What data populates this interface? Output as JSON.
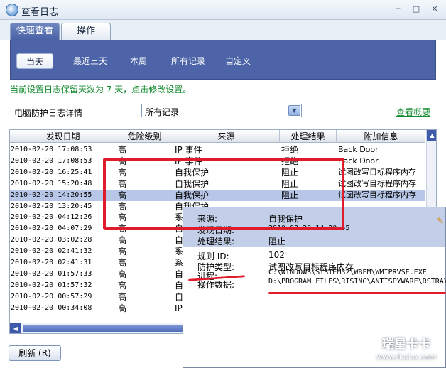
{
  "window": {
    "title": "查看日志",
    "controls": [
      "─",
      "□",
      "✕"
    ]
  },
  "tabs": [
    {
      "label": "快速查看",
      "active": true
    },
    {
      "label": "操作",
      "active": false
    }
  ],
  "filters": [
    {
      "label": "当天",
      "active": true
    },
    {
      "label": "最近三天",
      "active": false
    },
    {
      "label": "本周",
      "active": false
    },
    {
      "label": "所有记录",
      "active": false
    },
    {
      "label": "自定义",
      "active": false
    }
  ],
  "notice": "当前设置日志保留天数为 7 天，点击修改设置。",
  "detail": {
    "label": "电脑防护日志详情",
    "select_value": "所有记录",
    "overview_link": "查看概要"
  },
  "table": {
    "headers": [
      "发现日期",
      "危险级别",
      "来源",
      "处理结果",
      "附加信息"
    ],
    "rows": [
      {
        "date": "2010-02-20 17:08:53",
        "level": "高",
        "source": "IP 事件",
        "result": "拒绝",
        "info": "Back Door"
      },
      {
        "date": "2010-02-20 17:08:53",
        "level": "高",
        "source": "IP 事件",
        "result": "拒绝",
        "info": "Back Door"
      },
      {
        "date": "2010-02-20 16:25:41",
        "level": "高",
        "source": "自我保护",
        "result": "阻止",
        "info": "试图改写目标程序内存"
      },
      {
        "date": "2010-02-20 15:20:48",
        "level": "高",
        "source": "自我保护",
        "result": "阻止",
        "info": "试图改写目标程序内存"
      },
      {
        "date": "2010-02-20 14:20:55",
        "level": "高",
        "source": "自我保护",
        "result": "阻止",
        "info": "试图改写目标程序内存",
        "selected": true
      },
      {
        "date": "2010-02-20 13:20:45",
        "level": "高",
        "source": "自我保护",
        "result": "",
        "info": ""
      },
      {
        "date": "2010-02-20 04:12:26",
        "level": "高",
        "source": "系",
        "result": "",
        "info": ""
      },
      {
        "date": "2010-02-20 04:07:29",
        "level": "高",
        "source": "自",
        "result": "",
        "info": ""
      },
      {
        "date": "2010-02-20 03:02:28",
        "level": "高",
        "source": "自",
        "result": "",
        "info": ""
      },
      {
        "date": "2010-02-20 02:41:32",
        "level": "高",
        "source": "系",
        "result": "",
        "info": ""
      },
      {
        "date": "2010-02-20 02:41:31",
        "level": "高",
        "source": "系",
        "result": "",
        "info": ""
      },
      {
        "date": "2010-02-20 01:57:33",
        "level": "高",
        "source": "自",
        "result": "",
        "info": ""
      },
      {
        "date": "2010-02-20 01:57:32",
        "level": "高",
        "source": "自",
        "result": "",
        "info": ""
      },
      {
        "date": "2010-02-20 00:57:29",
        "level": "高",
        "source": "自",
        "result": "",
        "info": ""
      },
      {
        "date": "2010-02-20 00:34:08",
        "level": "高",
        "source": "IP",
        "result": "",
        "info": ""
      }
    ]
  },
  "refresh_button": "刷新 (R)",
  "popup": {
    "source_label": "来源:",
    "source_value": "自我保护",
    "date_label": "发现日期:",
    "date_value": "2010-02-20 14:20:55",
    "result_label": "处理结果:",
    "result_value": "阻止",
    "rule_label": "规则 ID:",
    "rule_value": "102",
    "type_label": "防护类型:",
    "type_value": "试图改写目标程序内存",
    "process_label": "进程:",
    "process_value": "C:\\WINDOWS\\SYSTEM32\\WBEM\\WMIPRVSE.EXE",
    "data_label": "操作数据:",
    "data_value": "D:\\PROGRAM FILES\\RISING\\ANTISPYWARE\\RSTRAY"
  },
  "watermark": {
    "title": "瑞星卡卡",
    "url": "www.ikaka.com"
  },
  "colors": {
    "annotation_red": "#e01c2c",
    "link_green": "#128a2e",
    "panel_blue": "#4d64a8"
  }
}
